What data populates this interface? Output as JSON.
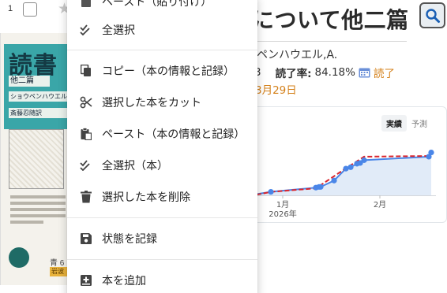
{
  "row": {
    "number": "1"
  },
  "book": {
    "title": "について他二篇",
    "author": "ペンハウエル,A.",
    "stats_prefix": "3",
    "read_rate_label": "読了率:",
    "read_rate_value": "84.18%",
    "read_link": "読了",
    "date": "3月29日"
  },
  "cover": {
    "title": "読書",
    "subtitle": "他二篇",
    "author_line": "ショウペンハウエル",
    "translator_line": "斎藤忍随訳",
    "price": "青 6",
    "tag": "岩波"
  },
  "chart_tabs": [
    {
      "label": "実績",
      "active": true
    },
    {
      "label": "予測",
      "active": false
    }
  ],
  "chart_data": {
    "type": "line",
    "title": "",
    "xlabel": "",
    "ylabel": "",
    "x_ticks": [
      {
        "label": "1月",
        "sub": "2026年"
      },
      {
        "label": "2月",
        "sub": ""
      }
    ],
    "series": [
      {
        "values": [
          0.0,
          0.05,
          0.11,
          0.12,
          0.12,
          0.21,
          0.38,
          0.4,
          0.45,
          0.46,
          0.5,
          0.55,
          0.61
        ]
      }
    ],
    "trend_color": "#d9262e",
    "line_color": "#4a86e8"
  },
  "menu": {
    "items": [
      {
        "id": "paste-top",
        "label": "ペースト（貼り付け）",
        "icon": "clipboard-icon"
      },
      {
        "id": "select-all",
        "label": "全選択",
        "icon": "double-check-icon"
      },
      {
        "id": "copy-book",
        "label": "コピー（本の情報と記録）",
        "icon": "copy-icon"
      },
      {
        "id": "cut-book",
        "label": "選択した本をカット",
        "icon": "scissors-icon"
      },
      {
        "id": "paste-book",
        "label": "ペースト（本の情報と記録）",
        "icon": "paste-icon"
      },
      {
        "id": "select-all-books",
        "label": "全選択（本）",
        "icon": "double-check-icon"
      },
      {
        "id": "delete-book",
        "label": "選択した本を削除",
        "icon": "trash-icon"
      },
      {
        "id": "save-state",
        "label": "状態を記録",
        "icon": "floppy-icon"
      },
      {
        "id": "add-book",
        "label": "本を追加",
        "icon": "add-box-icon"
      }
    ]
  }
}
